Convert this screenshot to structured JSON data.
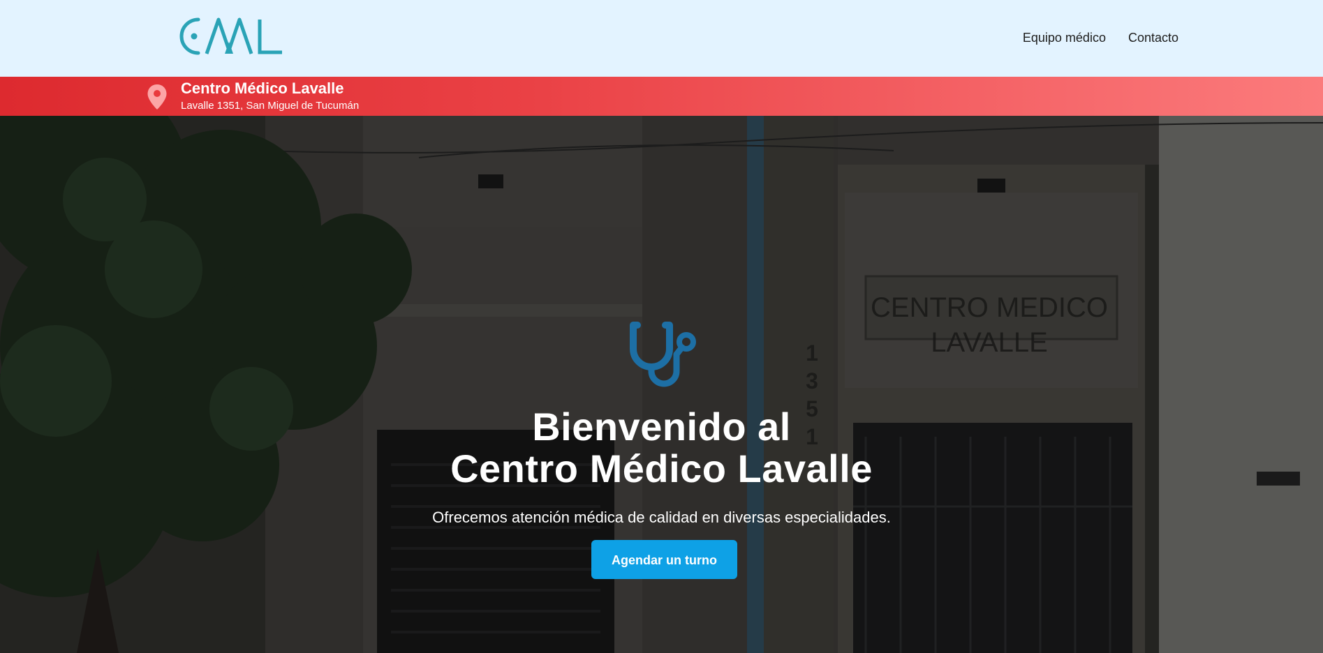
{
  "header": {
    "logo_text": "CML",
    "nav": [
      {
        "label": "Equipo médico"
      },
      {
        "label": "Contacto"
      }
    ]
  },
  "location": {
    "name": "Centro Médico Lavalle",
    "address": "Lavalle 1351, San Miguel de Tucumán",
    "icon": "map-pin-icon"
  },
  "hero": {
    "icon": "stethoscope-icon",
    "title_line1": "Bienvenido al",
    "title_line2": "Centro Médico Lavalle",
    "subtitle": "Ofrecemos atención médica de calidad en diversas especialidades.",
    "cta_label": "Agendar un turno",
    "building_sign": [
      "CENTRO MEDICO",
      "LAVALLE"
    ],
    "building_number": [
      "1",
      "3",
      "5",
      "1"
    ]
  },
  "colors": {
    "header_bg": "#e3f3ff",
    "brand_teal": "#2aa3b6",
    "location_bar_start": "#dd2a2f",
    "location_bar_end": "#fb7b7c",
    "cta_bg": "#0ea1e6",
    "icon_blue": "#1d6fa5"
  }
}
